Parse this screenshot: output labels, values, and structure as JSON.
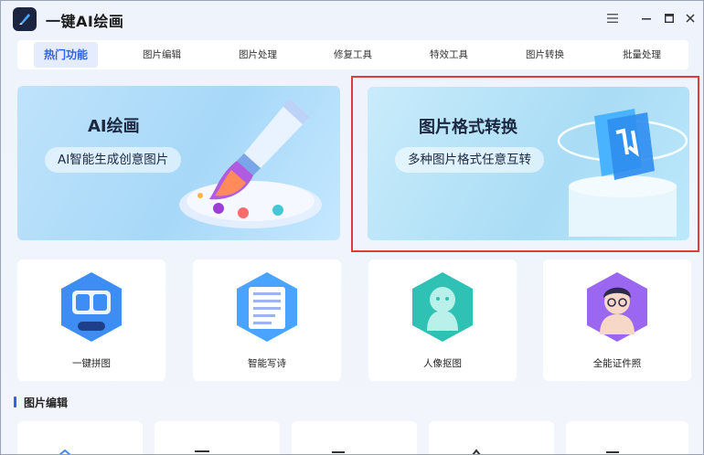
{
  "app": {
    "title": "一键AI绘画"
  },
  "tabs": [
    {
      "label": "热门功能",
      "active": true
    },
    {
      "label": "图片编辑"
    },
    {
      "label": "图片处理"
    },
    {
      "label": "修复工具"
    },
    {
      "label": "特效工具"
    },
    {
      "label": "图片转换"
    },
    {
      "label": "批量处理"
    }
  ],
  "banners": {
    "ai": {
      "title": "AI绘画",
      "subtitle": "AI智能生成创意图片"
    },
    "format": {
      "title": "图片格式转换",
      "subtitle": "多种图片格式任意互转"
    }
  },
  "features": [
    {
      "label": "一键拼图",
      "icon": "collage-icon"
    },
    {
      "label": "智能写诗",
      "icon": "poem-icon"
    },
    {
      "label": "人像抠图",
      "icon": "portrait-cutout-icon"
    },
    {
      "label": "全能证件照",
      "icon": "id-photo-icon"
    }
  ],
  "section": {
    "title": "图片编辑"
  },
  "colors": {
    "accent": "#2f63e8",
    "highlight": "#e03b3b"
  }
}
